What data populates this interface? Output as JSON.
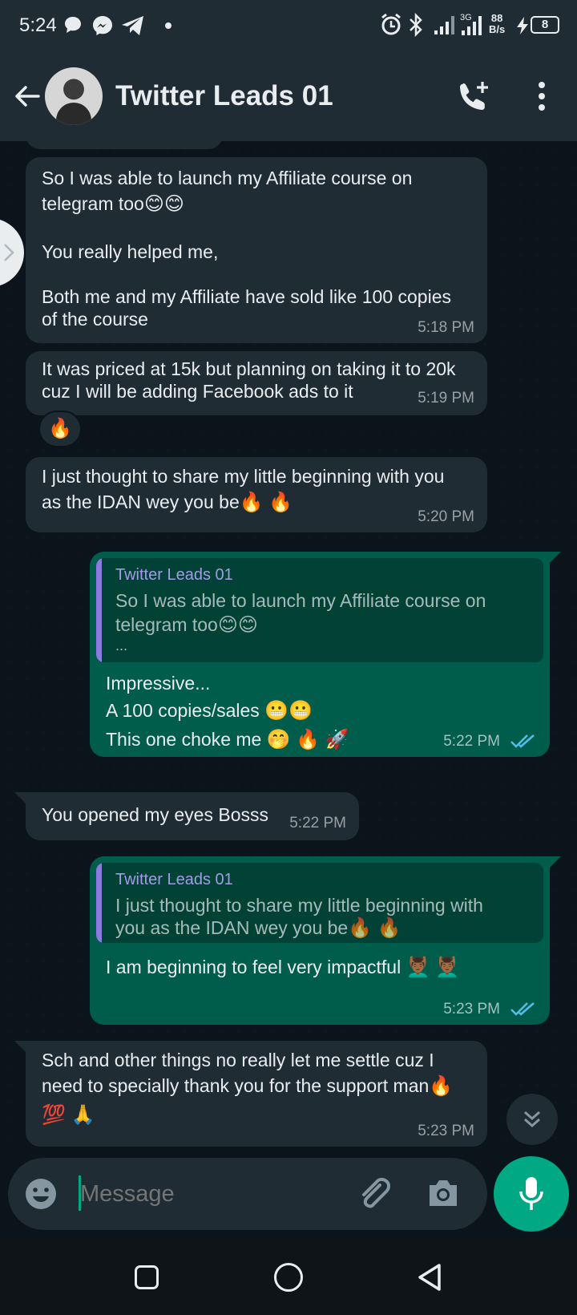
{
  "status_bar": {
    "time": "5:24",
    "network_speed_top": "88",
    "network_speed_bottom": "B/s",
    "battery": "8"
  },
  "header": {
    "title": "Twitter Leads 01"
  },
  "messages": [
    {
      "line1": "So I was able to launch my Affiliate course on",
      "line2": "telegram too",
      "line2_emoji": "😊😊",
      "line3": "You really helped me,",
      "line4": "Both me and my Affiliate have sold like 100 copies",
      "line5": "of the course",
      "time": "5:18 PM"
    },
    {
      "line1": "It was priced at 15k but planning on taking it to 20k",
      "line2": "cuz I will be adding Facebook ads to it",
      "time": "5:19 PM",
      "reaction": "🔥"
    },
    {
      "line1": "I just thought to share my little beginning with you",
      "line2": "as the IDAN wey you be",
      "line2_emoji": "🔥 🔥",
      "time": "5:20 PM"
    },
    {
      "quote_name": "Twitter Leads 01",
      "quote_line1": "So I was able to launch my Affiliate course on",
      "quote_line2": "telegram too",
      "quote_line2_emoji": "😊😊",
      "quote_more": "...",
      "line1": "Impressive...",
      "line2": "A 100 copies/sales ",
      "line2_emoji": "😬😬",
      "line3": "This one choke me ",
      "line3_emoji": "🤭 🔥 🚀",
      "time": "5:22 PM"
    },
    {
      "line1": "You opened my eyes Bosss",
      "time": "5:22 PM"
    },
    {
      "quote_name": "Twitter Leads 01",
      "quote_line1": "I just thought to share my little beginning with",
      "quote_line2": "you as the IDAN wey you be",
      "quote_line2_emoji": "🔥 🔥",
      "line1": "I am beginning to feel very impactful ",
      "line1_emoji": "💆🏾‍♂️ 💆🏾‍♂️",
      "time": "5:23 PM"
    },
    {
      "line1": "Sch and other things no really let me settle cuz I",
      "line2": "need to specially thank you for the support man",
      "line2_emoji": "🔥",
      "line3_emoji": "💯 🙏",
      "time": "5:23 PM"
    }
  ],
  "input": {
    "placeholder": "Message"
  },
  "icons": {
    "back": "arrow-left-icon",
    "call": "add-call-icon",
    "menu": "more-vert-icon",
    "emoji": "emoji-icon",
    "attach": "paperclip-icon",
    "camera": "camera-icon",
    "mic": "mic-icon",
    "scroll": "chevron-double-down-icon",
    "read": "double-check-icon"
  },
  "colors": {
    "incoming": "#1f2c34",
    "outgoing": "#005c4b",
    "accent": "#00a884",
    "read_ticks": "#53bdeb",
    "quote_name": "#a49ae8"
  }
}
